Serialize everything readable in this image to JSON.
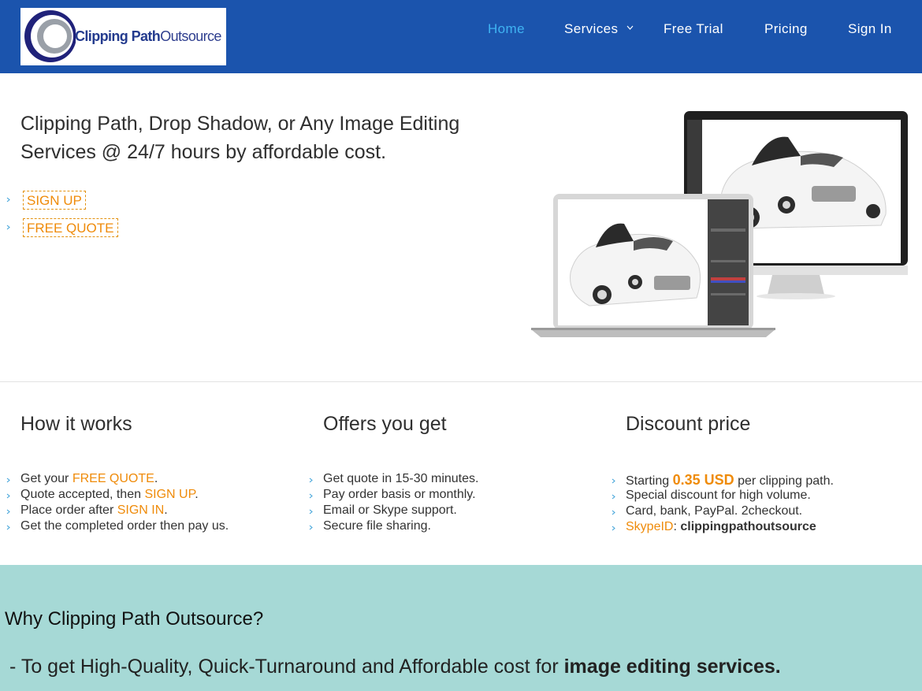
{
  "brand": {
    "bold": "Clipping Path",
    "light": "Outsource"
  },
  "nav": {
    "home": "Home",
    "services": "Services",
    "free_trial": "Free Trial",
    "pricing": "Pricing",
    "sign_in": "Sign In",
    "active_color": "#3fb3f2"
  },
  "hero": {
    "title": "Clipping Path, Drop Shadow, or Any Image Editing Services @ 24/7 hours by affordable cost.",
    "links": [
      "SIGN UP",
      "FREE QUOTE"
    ]
  },
  "features": {
    "how": {
      "title": "How it works",
      "items": [
        {
          "pre": "Get your ",
          "link": "FREE QUOTE",
          "post": "."
        },
        {
          "pre": "Quote accepted, then ",
          "link": "SIGN UP",
          "post": "."
        },
        {
          "pre": "Place order after ",
          "link": "SIGN IN",
          "post": "."
        },
        {
          "pre": "Get the completed order then pay us.",
          "link": "",
          "post": ""
        }
      ]
    },
    "offers": {
      "title": "Offers you get",
      "items": [
        "Get quote in 15-30 minutes.",
        "Pay order basis or monthly.",
        "Email or Skype support.",
        "Secure file sharing."
      ]
    },
    "discount": {
      "title": "Discount price",
      "price_pre": "Starting ",
      "price": "0.35 USD",
      "price_post": " per clipping path.",
      "items": [
        "Special discount for high volume.",
        "Card, bank, PayPal. 2checkout."
      ],
      "skype_label": "SkypeID",
      "skype_sep": ": ",
      "skype_id": "clippingpathoutsource"
    }
  },
  "why": {
    "title": "Why Clipping Path Outsource?",
    "text_pre": "- To get High-Quality, Quick-Turnaround and Affordable cost for ",
    "text_bold": "image editing services."
  },
  "colors": {
    "header": "#1b54ad",
    "accent": "#ef8b0a",
    "why_bg": "#a6d9d6"
  }
}
